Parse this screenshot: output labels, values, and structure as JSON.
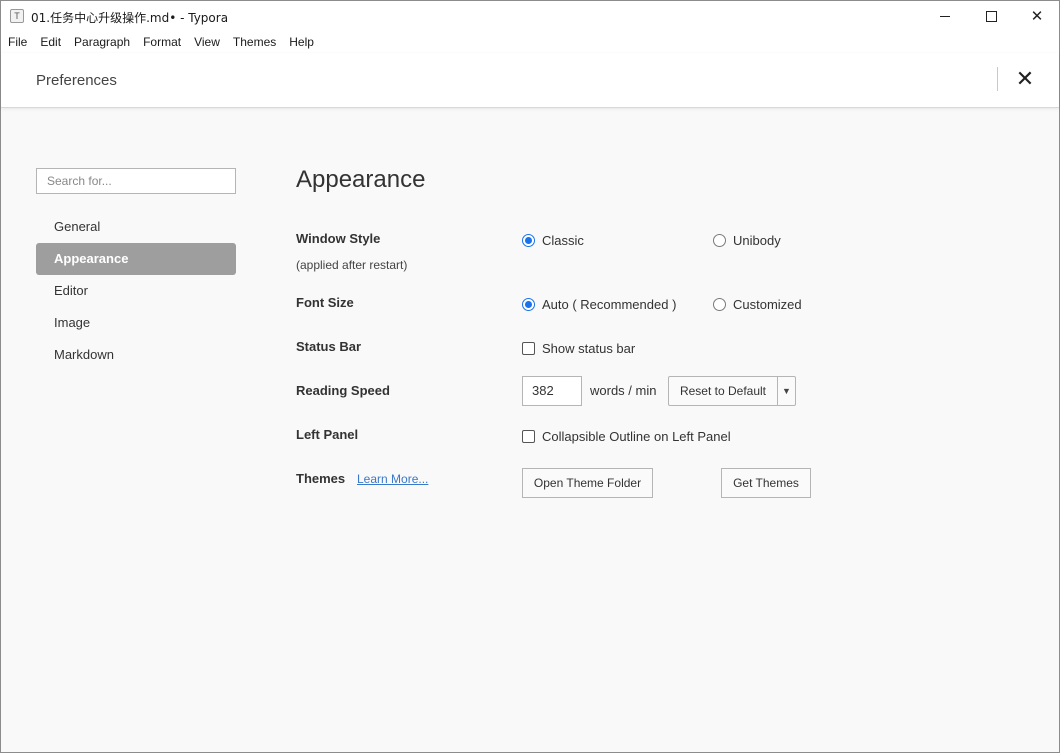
{
  "window": {
    "app_icon_letter": "T",
    "title": "01.任务中心升级操作.md• - Typora",
    "minimize_icon": "minimize-icon",
    "maximize_icon": "maximize-icon",
    "close_glyph": "✕"
  },
  "menu": [
    "File",
    "Edit",
    "Paragraph",
    "Format",
    "View",
    "Themes",
    "Help"
  ],
  "prefs": {
    "title": "Preferences",
    "close_glyph": "✕"
  },
  "sidebar": {
    "search_placeholder": "Search for...",
    "items": [
      {
        "label": "General",
        "active": false
      },
      {
        "label": "Appearance",
        "active": true
      },
      {
        "label": "Editor",
        "active": false
      },
      {
        "label": "Image",
        "active": false
      },
      {
        "label": "Markdown",
        "active": false
      }
    ]
  },
  "main": {
    "section_title": "Appearance",
    "window_style": {
      "label": "Window Style",
      "sub": "(applied after restart)",
      "options": [
        "Classic",
        "Unibody"
      ],
      "selected": "Classic"
    },
    "font_size": {
      "label": "Font Size",
      "options": [
        "Auto ( Recommended )",
        "Customized"
      ],
      "selected": "Auto ( Recommended )"
    },
    "status_bar": {
      "label": "Status Bar",
      "checkbox_label": "Show status bar",
      "checked": false
    },
    "reading_speed": {
      "label": "Reading Speed",
      "value": "382",
      "unit": "words / min",
      "reset_label": "Reset to Default",
      "dropdown_glyph": "▼"
    },
    "left_panel": {
      "label": "Left Panel",
      "checkbox_label": "Collapsible Outline on Left Panel",
      "checked": false
    },
    "themes": {
      "label": "Themes",
      "learn_more": "Learn More...",
      "open_folder": "Open Theme Folder",
      "get_themes": "Get Themes"
    }
  },
  "colors": {
    "accent": "#1a73e8",
    "active_nav_bg": "#9e9e9e",
    "link": "#3a78c9"
  }
}
